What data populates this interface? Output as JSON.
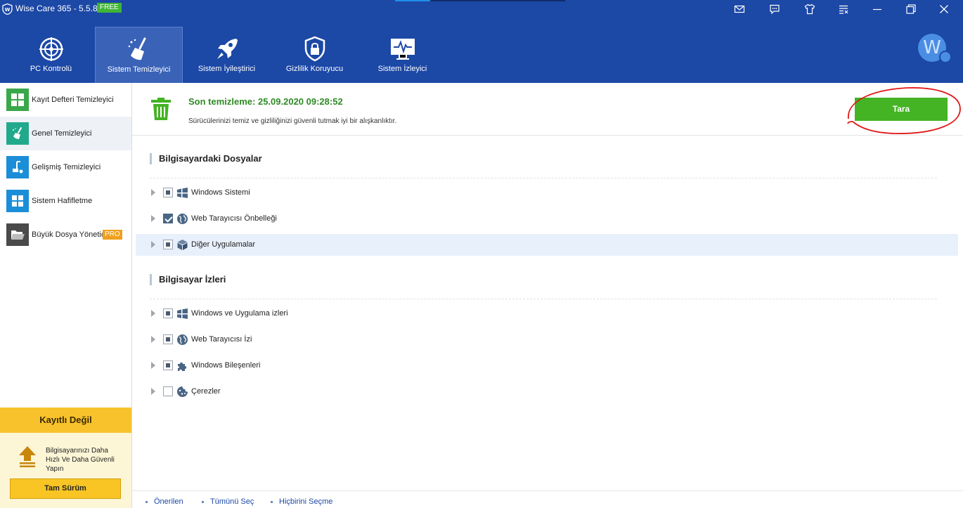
{
  "app": {
    "title": "Wise Care 365 - 5.5.8",
    "badge": "FREE",
    "avatar_letter": "W"
  },
  "titlebar_icons": [
    "mail-icon",
    "message-icon",
    "skin-icon",
    "settings-menu-icon",
    "minimize-icon",
    "restore-icon",
    "close-icon"
  ],
  "nav": {
    "items": [
      {
        "label": "PC Kontrolü",
        "icon": "radar-icon"
      },
      {
        "label": "Sistem Temizleyici",
        "icon": "broom-icon"
      },
      {
        "label": "Sistem İyileştirici",
        "icon": "rocket-icon"
      },
      {
        "label": "Gizlilik Koruyucu",
        "icon": "shield-lock-icon"
      },
      {
        "label": "Sistem İzleyici",
        "icon": "monitor-pulse-icon"
      }
    ],
    "active_index": 1
  },
  "sidebar": {
    "items": [
      {
        "label": "Kayıt Defteri Temizleyici",
        "icon": "registry-icon",
        "color": "#3aa84a"
      },
      {
        "label": "Genel Temizleyici",
        "icon": "broom-icon",
        "color": "#22a98c"
      },
      {
        "label": "Gelişmiş Temizleyici",
        "icon": "vacuum-icon",
        "color": "#1b8ed8"
      },
      {
        "label": "Sistem Hafifletme",
        "icon": "windows-icon",
        "color": "#1b8ed8"
      },
      {
        "label": "Büyük Dosya Yönetic",
        "icon": "folder-icon",
        "color": "#4a4a4a",
        "badge": "PRO"
      }
    ],
    "active_index": 1
  },
  "registration": {
    "title": "Kayıtlı Değil",
    "message": "Bilgisayarınızı Daha Hızlı Ve Daha Güvenli Yapın",
    "button": "Tam Sürüm"
  },
  "summary": {
    "last_clean": "Son temizleme: 25.09.2020 09:28:52",
    "text": "Sürücülerinizi temiz ve gizliliğinizi güvenli tutmak iyi bir alışkanlıktır.",
    "scan_button": "Tara"
  },
  "groups": [
    {
      "title": "Bilgisayardaki Dosyalar",
      "items": [
        {
          "label": "Windows Sistemi",
          "state": "partial",
          "icon": "windows-flag-icon"
        },
        {
          "label": "Web Tarayıcısı Önbelleği",
          "state": "checked",
          "icon": "globe-icon"
        },
        {
          "label": "Diğer Uygulamalar",
          "state": "partial",
          "icon": "cube-icon"
        }
      ]
    },
    {
      "title": "Bilgisayar İzleri",
      "items": [
        {
          "label": "Windows ve Uygulama izleri",
          "state": "partial",
          "icon": "windows-flag-icon"
        },
        {
          "label": "Web Tarayıcısı İzi",
          "state": "partial",
          "icon": "globe-icon"
        },
        {
          "label": "Windows Bileşenleri",
          "state": "partial",
          "icon": "puzzle-icon"
        },
        {
          "label": "Çerezler",
          "state": "unchecked",
          "icon": "cookie-icon"
        }
      ]
    }
  ],
  "footer": {
    "recommended": "Önerilen",
    "select_all": "Tümünü Seç",
    "select_none": "Hiçbirini Seçme"
  },
  "colors": {
    "header": "#1c48a6",
    "scan_button": "#44b324",
    "registration": "#f7c22c",
    "annotation": "#e01818"
  }
}
